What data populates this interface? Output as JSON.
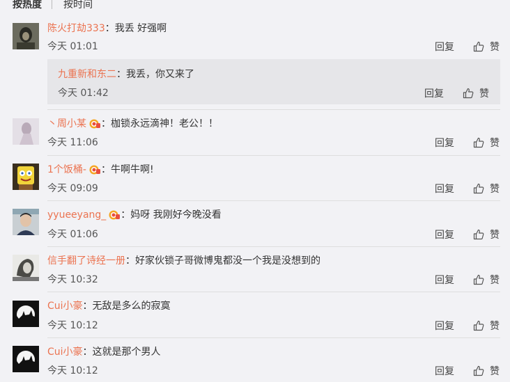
{
  "tabs": {
    "hot": "按热度",
    "time": "按时间"
  },
  "actions": {
    "reply": "回复",
    "like": "赞"
  },
  "colors": {
    "username": "#eb7350",
    "background": "#f2f2f5",
    "subreply_bg": "#e6e6e9"
  },
  "comments": [
    {
      "user": "陈火打劫333",
      "sep": "：",
      "text": "我丢  好强啊",
      "time": "今天 01:01",
      "vip": false,
      "avatar": "dark-portrait"
    },
    {
      "user": "丶周小某",
      "sep": "：",
      "text": "枷锁永远滴神！老公！！",
      "time": "今天 11:06",
      "vip": true,
      "avatar": "pale-figure"
    },
    {
      "user": "1个饭桶-",
      "sep": "：",
      "text": "牛啊牛啊!",
      "time": "今天 09:09",
      "vip": true,
      "avatar": "sponge-character"
    },
    {
      "user": "yyueeyang_",
      "sep": "：",
      "text": "妈呀 我刚好今晚没看",
      "time": "今天 01:06",
      "vip": true,
      "avatar": "boy-portrait"
    },
    {
      "user": "信手翻了诗经一册",
      "sep": "：",
      "text": "好家伙锁子哥微博鬼都没一个我是没想到的",
      "time": "今天 10:32",
      "vip": false,
      "avatar": "sketch-face"
    },
    {
      "user": "Cui小豪",
      "sep": "：",
      "text": "无敌是多么的寂寞",
      "time": "今天 10:12",
      "vip": false,
      "avatar": "moon-silhouette"
    },
    {
      "user": "Cui小豪",
      "sep": "：",
      "text": "这就是那个男人",
      "time": "今天 10:12",
      "vip": false,
      "avatar": "moon-silhouette"
    }
  ],
  "subreply": {
    "user": "九重新和东二",
    "sep": "：",
    "text": "我丢，你又来了",
    "time": "今天 01:42"
  }
}
